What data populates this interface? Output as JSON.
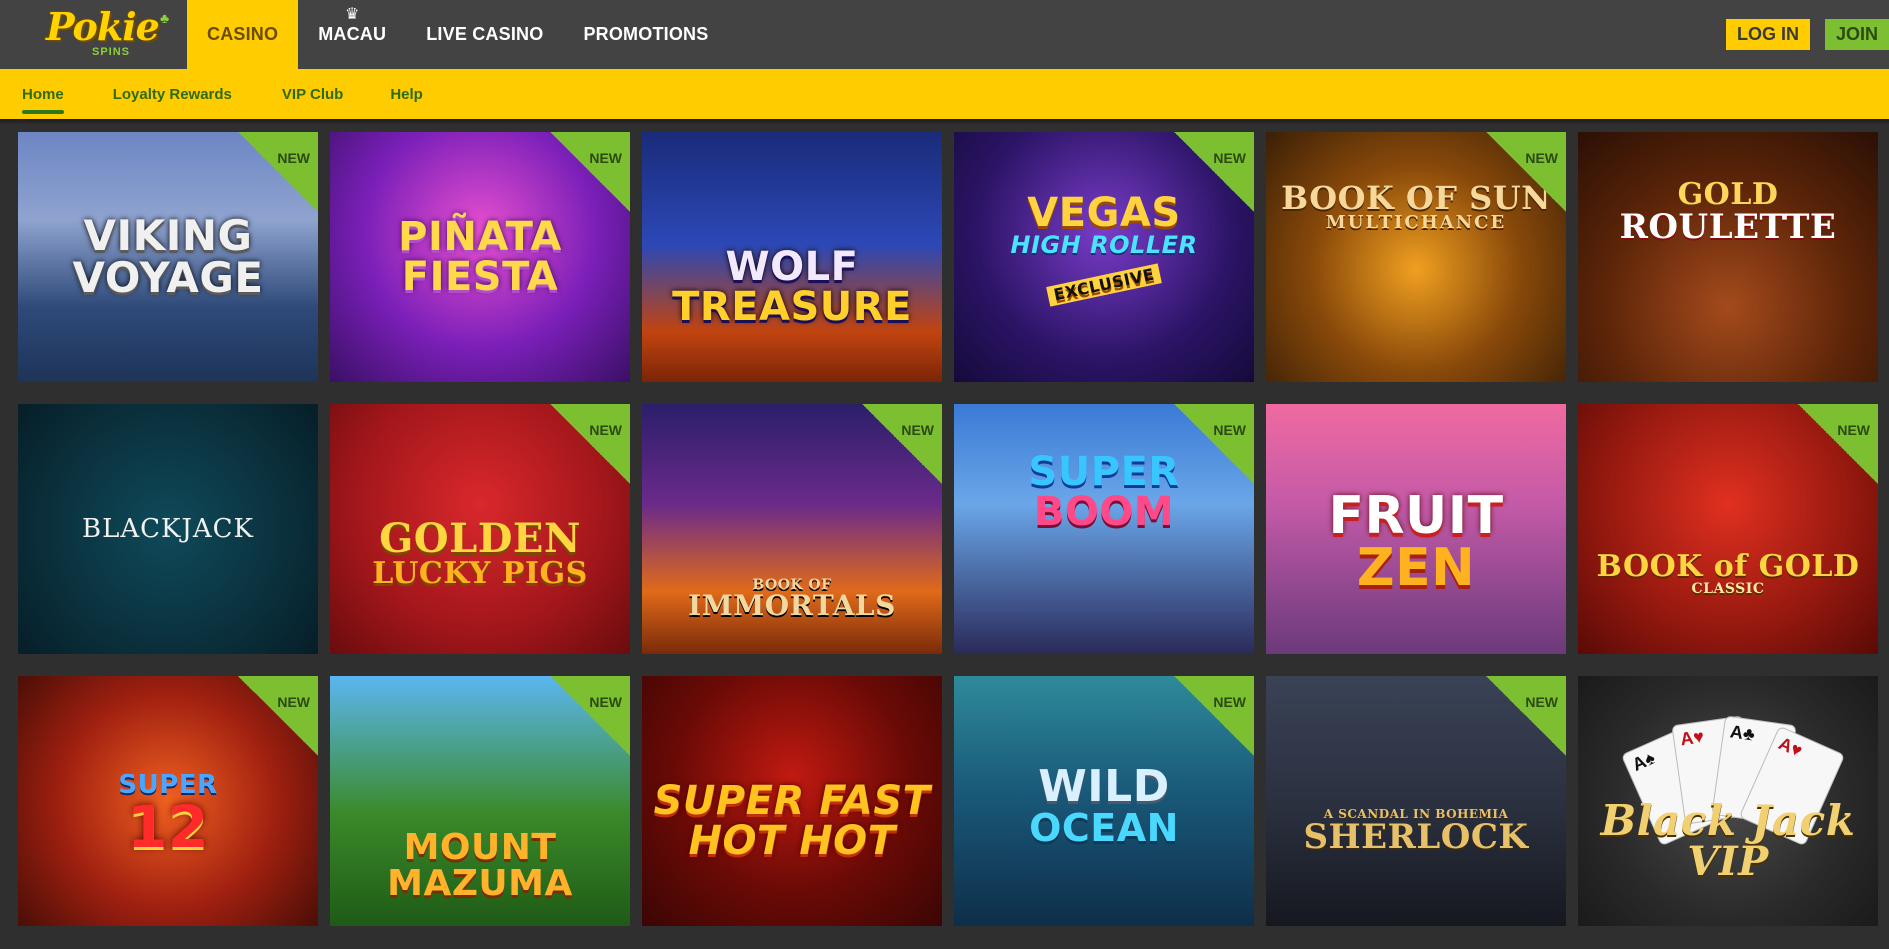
{
  "brand": {
    "logo_word": "Pokie",
    "logo_sub": "SPINS"
  },
  "main_nav": {
    "items": [
      {
        "label": "CASINO",
        "active": true
      },
      {
        "label": "MACAU",
        "icon": "crown-icon"
      },
      {
        "label": "LIVE CASINO"
      },
      {
        "label": "PROMOTIONS"
      }
    ]
  },
  "auth": {
    "login_label": "LOG IN",
    "join_label": "JOIN"
  },
  "sub_nav": {
    "items": [
      {
        "label": "Home",
        "active": true
      },
      {
        "label": "Loyalty Rewards"
      },
      {
        "label": "VIP Club"
      },
      {
        "label": "Help"
      }
    ]
  },
  "badge_label": "NEW",
  "games": [
    {
      "line1": "VIKING",
      "line2": "VOYAGE",
      "new": true
    },
    {
      "line1": "PIÑATA",
      "line2": "FIESTA",
      "new": true
    },
    {
      "line1": "WOLF",
      "line2": "TREASURE",
      "new": false
    },
    {
      "line1": "VEGAS",
      "line2": "HIGH ROLLER",
      "extra": "EXCLUSIVE",
      "new": true
    },
    {
      "line1": "BOOK OF SUN",
      "line2": "MULTICHANCE",
      "new": true
    },
    {
      "line1": "GOLD",
      "line2": "ROULETTE",
      "new": false
    },
    {
      "line1": "BLACKJACK",
      "new": false
    },
    {
      "line1": "GOLDEN",
      "line2": "LUCKY PIGS",
      "new": true
    },
    {
      "line1": "BOOK OF",
      "line2": "IMMORTALS",
      "new": true
    },
    {
      "line1": "SUPER",
      "line2": "BOOM",
      "new": true
    },
    {
      "line1": "FRUIT",
      "line2": "ZEN",
      "new": false
    },
    {
      "line1": "BOOK of GOLD",
      "line2": "CLASSIC",
      "new": true
    },
    {
      "line1": "SUPER",
      "line2": "12",
      "new": true
    },
    {
      "line1": "MOUNT",
      "line2": "MAZUMA",
      "new": true
    },
    {
      "line1": "SUPER FAST",
      "line2": "HOT HOT",
      "new": false
    },
    {
      "line1": "WILD",
      "line2": "OCEAN",
      "new": true
    },
    {
      "line1": "A SCANDAL IN BOHEMIA",
      "line2": "SHERLOCK",
      "new": true
    },
    {
      "line1": "Black Jack",
      "line2": "VIP",
      "new": false
    }
  ]
}
